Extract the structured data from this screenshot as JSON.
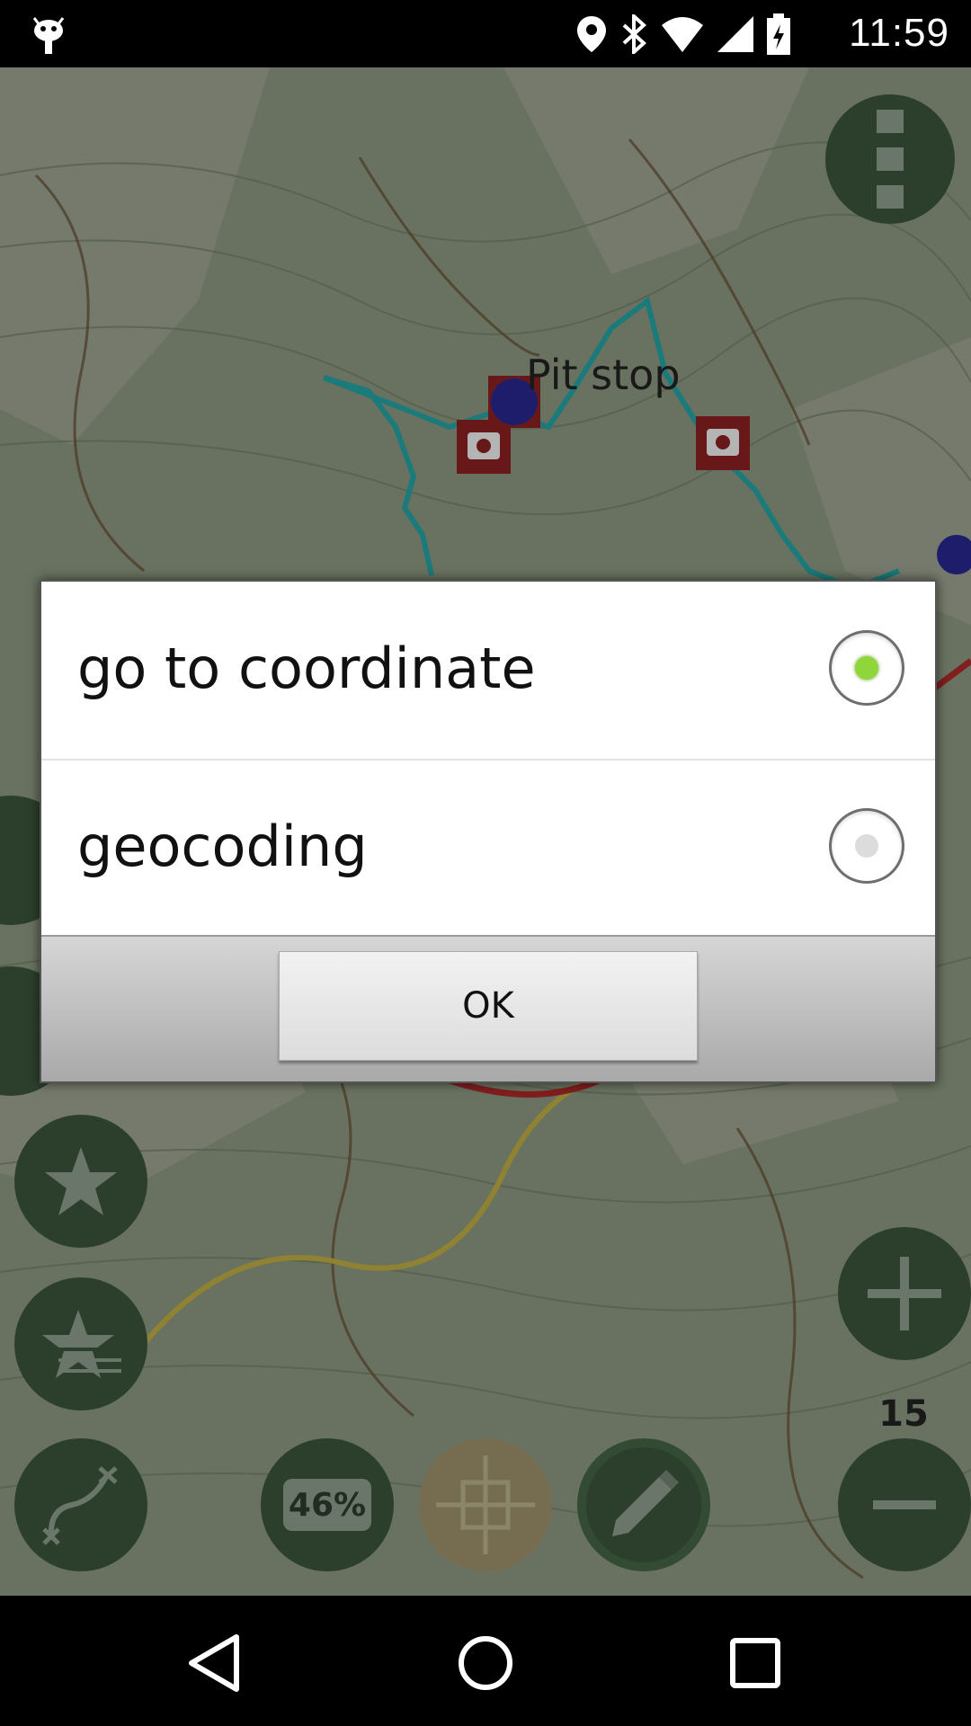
{
  "status_bar": {
    "time": "11:59",
    "icons": [
      "android-icon",
      "location-icon",
      "bluetooth-icon",
      "wifi-icon",
      "signal-icon",
      "battery-icon"
    ]
  },
  "map": {
    "waypoint_label": "Pit stop",
    "zoom_level": "15",
    "battery_badge": "46%"
  },
  "dialog": {
    "options": [
      {
        "label": "go to coordinate",
        "selected": true
      },
      {
        "label": "geocoding",
        "selected": false
      }
    ],
    "ok_label": "OK"
  },
  "colors": {
    "fab_bg": "#2e4c30",
    "radio_selected": "#8fd63a",
    "track_teal": "#15a6a6",
    "track_red": "#b11a1a"
  }
}
